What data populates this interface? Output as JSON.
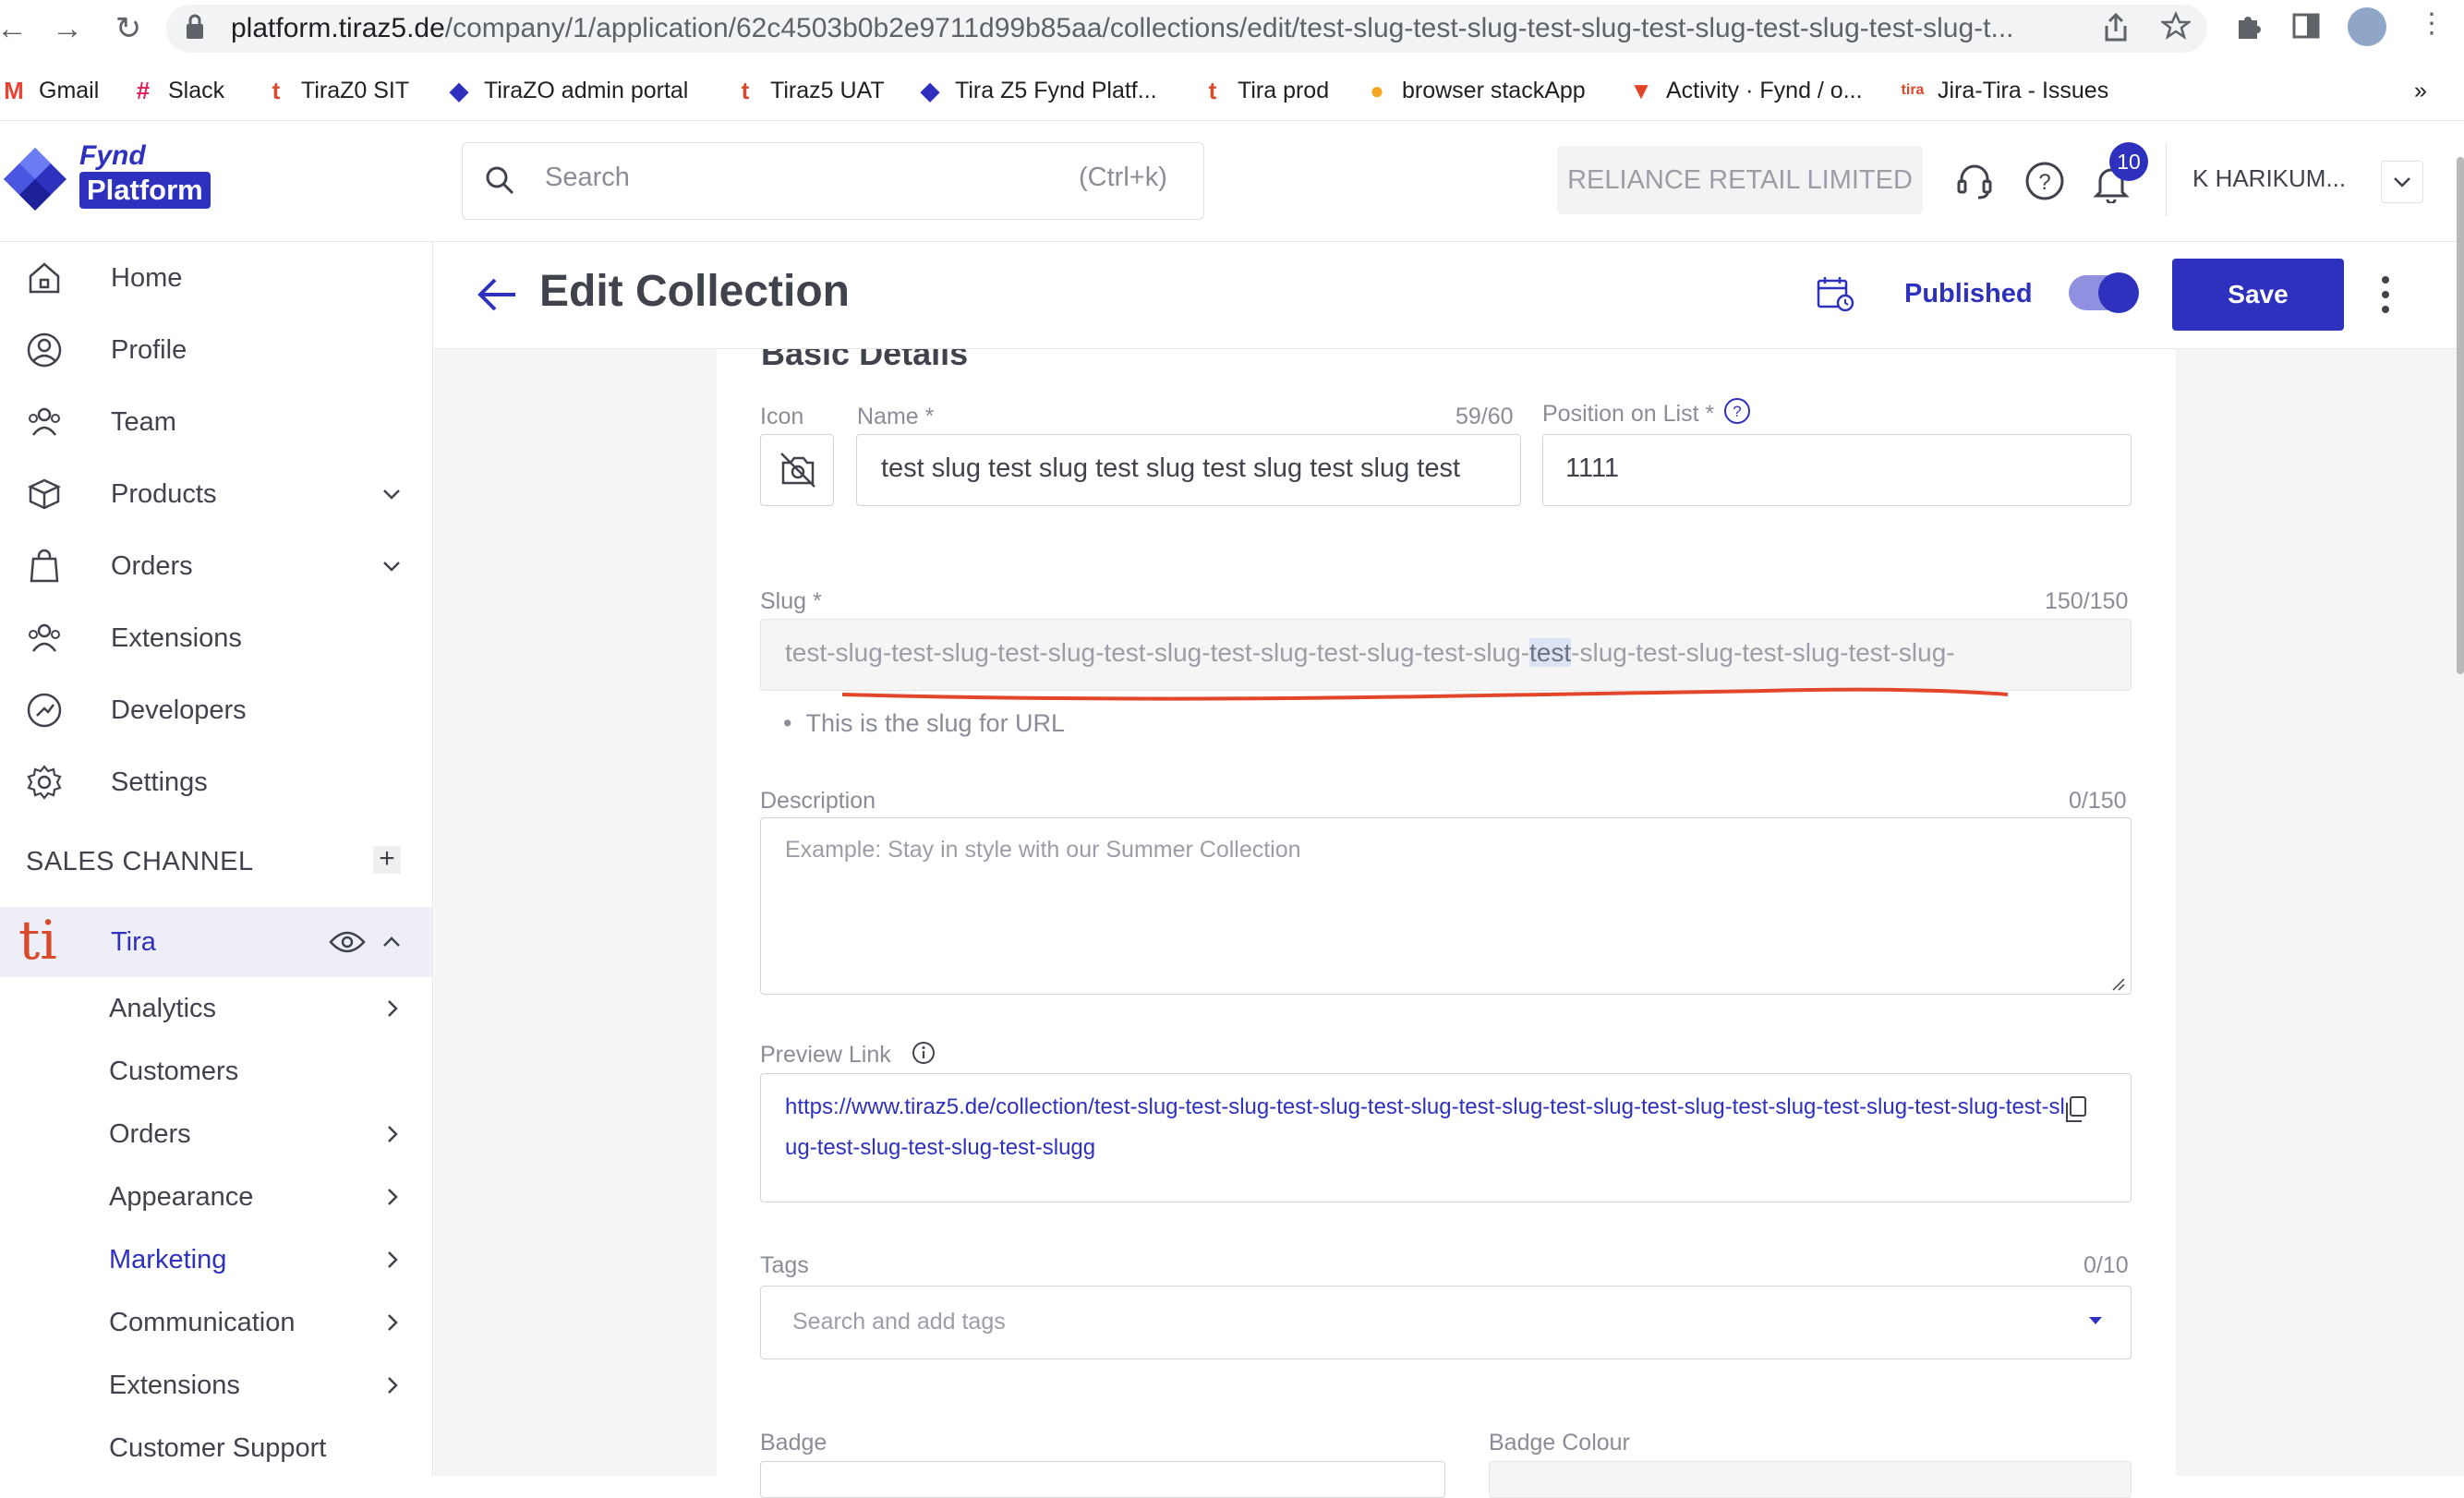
{
  "browser": {
    "url_host": "platform.tiraz5.de",
    "url_path": "/company/1/application/62c4503b0b2e9711d99b85aa/collections/edit/test-slug-test-slug-test-slug-test-slug-test-slug-test-slug-t...",
    "bookmarks": [
      {
        "label": "Gmail",
        "icon": "gmail-icon",
        "color": "#ea4335"
      },
      {
        "label": "Slack",
        "icon": "slack-icon",
        "color": "#e01e5a"
      },
      {
        "label": "TiraZ0 SIT",
        "icon": "tira-icon",
        "color": "#d94a2b"
      },
      {
        "label": "TiraZO admin portal",
        "icon": "fynd-icon",
        "color": "#2e31be"
      },
      {
        "label": "Tiraz5 UAT",
        "icon": "tira-icon",
        "color": "#d94a2b"
      },
      {
        "label": "Tira Z5 Fynd Platf...",
        "icon": "fynd-icon",
        "color": "#2e31be"
      },
      {
        "label": "Tira prod",
        "icon": "tira-icon",
        "color": "#d94a2b"
      },
      {
        "label": "browser stackApp",
        "icon": "browserstack-icon",
        "color": "#f5a623"
      },
      {
        "label": "Activity · Fynd / o...",
        "icon": "gitlab-icon",
        "color": "#e24329"
      },
      {
        "label": "Jira-Tira - Issues",
        "icon": "tira-icon",
        "color": "#d94a2b"
      }
    ],
    "more": "»"
  },
  "header": {
    "logo_top": "Fynd",
    "logo_bottom": "Platform",
    "search_placeholder": "Search",
    "search_shortcut": "(Ctrl+k)",
    "company": "RELIANCE RETAIL LIMITED",
    "notification_count": "10",
    "user_name": "K HARIKUM..."
  },
  "sidebar": {
    "items": [
      {
        "label": "Home",
        "icon": "home-icon"
      },
      {
        "label": "Profile",
        "icon": "profile-icon"
      },
      {
        "label": "Team",
        "icon": "team-icon"
      },
      {
        "label": "Products",
        "icon": "box-icon"
      },
      {
        "label": "Orders",
        "icon": "bag-icon"
      },
      {
        "label": "Extensions",
        "icon": "extensions-icon"
      },
      {
        "label": "Developers",
        "icon": "developers-icon"
      },
      {
        "label": "Settings",
        "icon": "gear-icon"
      }
    ],
    "sales_channel_title": "SALES CHANNEL",
    "channel": {
      "label": "Tira",
      "logo": "ti"
    },
    "sub_items": [
      {
        "label": "Analytics"
      },
      {
        "label": "Customers"
      },
      {
        "label": "Orders"
      },
      {
        "label": "Appearance"
      },
      {
        "label": "Marketing"
      },
      {
        "label": "Communication"
      },
      {
        "label": "Extensions"
      },
      {
        "label": "Customer Support"
      }
    ]
  },
  "page": {
    "title": "Edit Collection",
    "status": "Published",
    "save_label": "Save",
    "section_title": "Basic Details"
  },
  "form": {
    "icon_label": "Icon",
    "name_label": "Name *",
    "name_counter": "59/60",
    "name_value": "test slug test slug test slug test slug test slug test",
    "position_label": "Position on List *",
    "position_value": "1111",
    "slug_label": "Slug *",
    "slug_counter": "150/150",
    "slug_before": "test-slug-test-slug-test-slug-test-slug-test-slug-test-slug-test-slug-",
    "slug_highlight": "test",
    "slug_after": "-slug-test-slug-test-slug-test-slug-",
    "slug_hint": "This is the slug for URL",
    "description_label": "Description",
    "description_counter": "0/150",
    "description_placeholder": "Example: Stay in style with our Summer Collection",
    "preview_label": "Preview Link",
    "preview_url": "https://www.tiraz5.de/collection/test-slug-test-slug-test-slug-test-slug-test-slug-test-slug-test-slug-test-slug-test-slug-test-slug-test-slug-test-slug-test-slug-test-slugg",
    "tags_label": "Tags",
    "tags_counter": "0/10",
    "tags_placeholder": "Search and add tags",
    "badge_label": "Badge",
    "badge_colour_label": "Badge Colour"
  },
  "colors": {
    "primary": "#2e31be",
    "annotation": "#e2472b"
  }
}
